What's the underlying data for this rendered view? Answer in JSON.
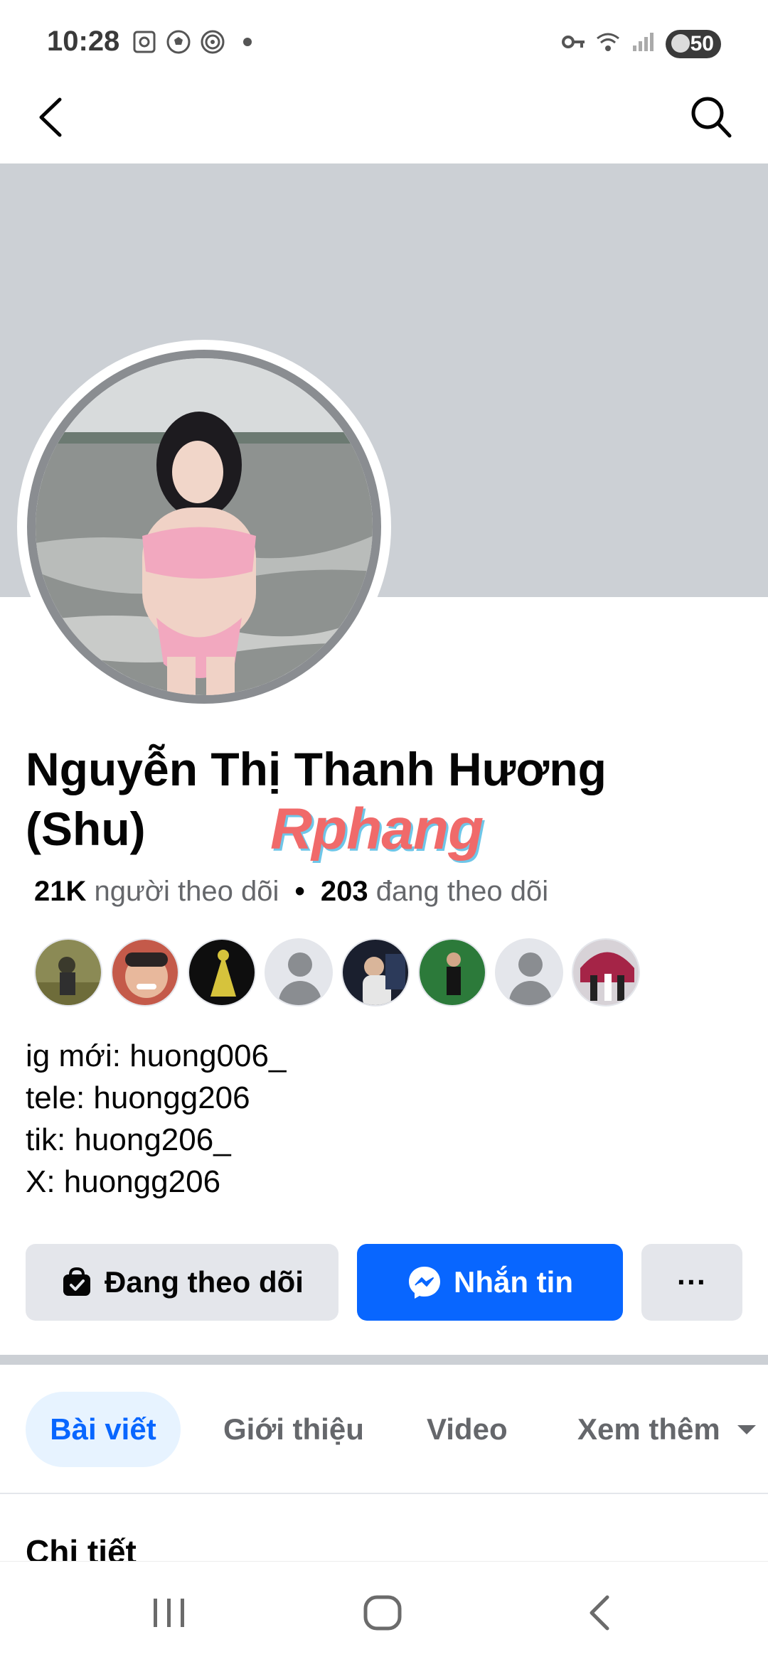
{
  "status_bar": {
    "time": "10:28",
    "battery": "50",
    "icons": [
      "screenshot-icon",
      "soccer-ball-icon",
      "target-icon",
      "dot-icon",
      "key-icon",
      "wifi-icon",
      "signal-icon",
      "battery-icon"
    ]
  },
  "header": {
    "back_icon": "chevron-left-icon",
    "search_icon": "search-icon"
  },
  "profile": {
    "name_line1": "Nguyễn Thị Thanh Hương",
    "name_line2": "(Shu)",
    "watermark": "Rphang",
    "followers_count": "21K",
    "followers_label": "người theo dõi",
    "separator": "•",
    "following_count": "203",
    "following_label": "đang theo dõi",
    "bio": [
      "ig mới: huong006_",
      "tele: huongg206",
      "tik: huong206_",
      "X: huongg206"
    ]
  },
  "actions": {
    "following_label": "Đang theo dõi",
    "message_label": "Nhắn tin",
    "more_label": "···"
  },
  "tabs": [
    {
      "label": "Bài viết",
      "active": true
    },
    {
      "label": "Giới thiệu",
      "active": false
    },
    {
      "label": "Video",
      "active": false
    },
    {
      "label": "Xem thêm",
      "active": false
    }
  ],
  "details_heading": "Chi tiết",
  "colors": {
    "accent": "#0866ff",
    "cover": "#ccd0d5",
    "button_gray": "#e4e6eb",
    "tab_active_bg": "#e7f3ff"
  }
}
